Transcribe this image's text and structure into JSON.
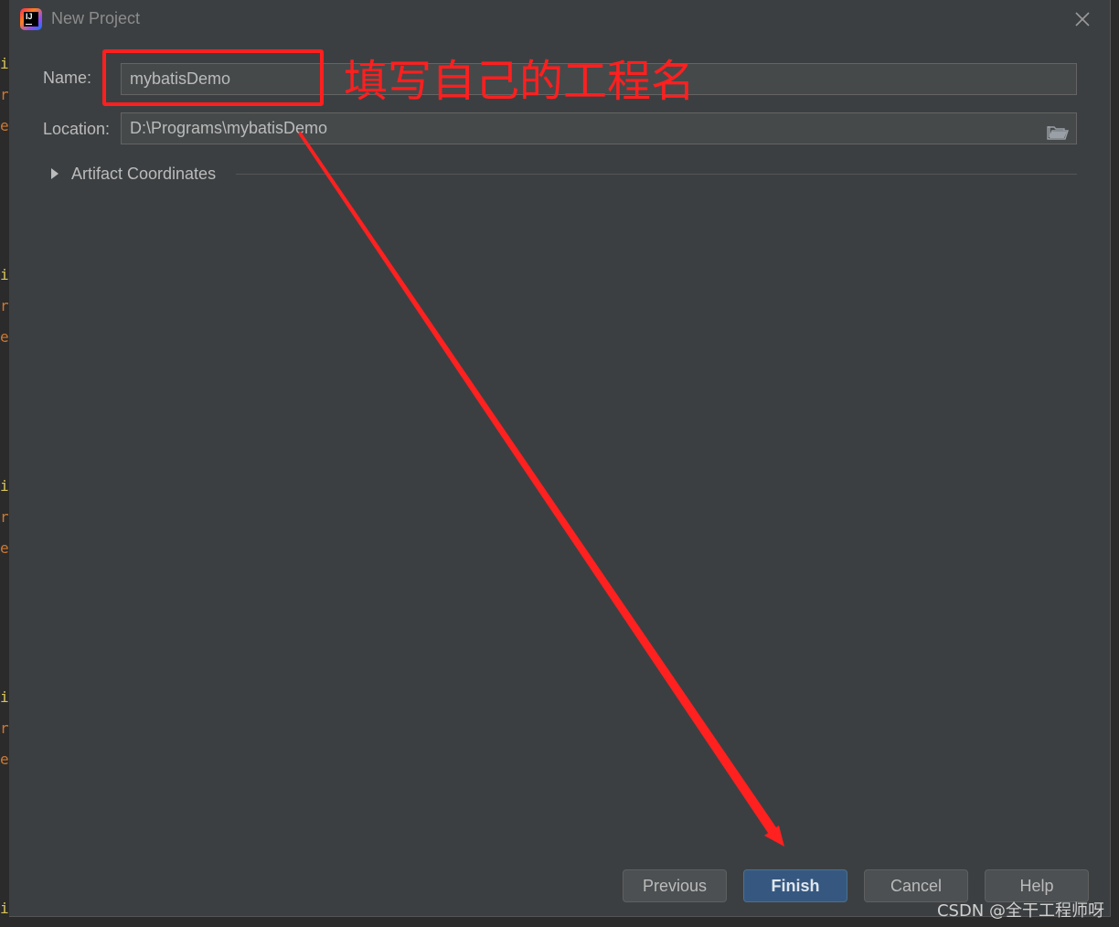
{
  "window": {
    "title": "New Project",
    "icon": "intellij-idea-icon",
    "icon_letters": "IJ"
  },
  "form": {
    "name_label": "Name:",
    "name_value": "mybatisDemo",
    "location_label": "Location:",
    "location_value": "D:\\Programs\\mybatisDemo",
    "artifact_label": "Artifact Coordinates"
  },
  "buttons": {
    "previous": "Previous",
    "finish": "Finish",
    "cancel": "Cancel",
    "help": "Help"
  },
  "annotation": {
    "text": "填写自己的工程名",
    "color": "#ff1f1f"
  },
  "watermark": "CSDN @全干工程师呀",
  "editor_glyphs": [
    "i",
    "r",
    "e",
    "i",
    "r",
    "e",
    "i",
    "r",
    "e",
    "i",
    "r",
    "e",
    "i"
  ],
  "colors": {
    "dialog_bg": "#3c3f41",
    "field_bg": "#45494a",
    "primary_button": "#365880",
    "text": "#bbbbbb"
  }
}
